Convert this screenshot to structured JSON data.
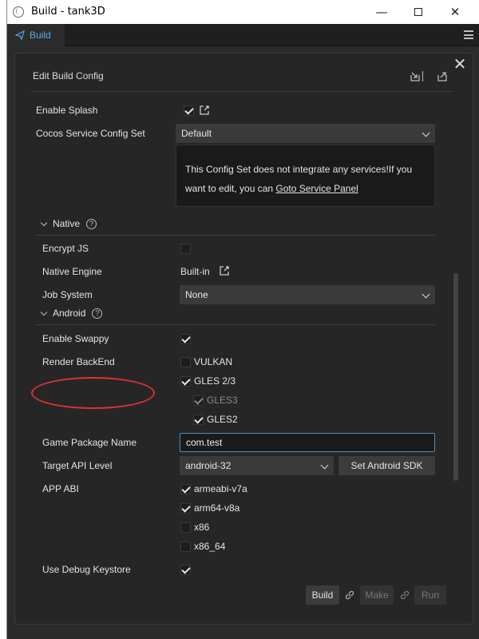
{
  "window": {
    "title": "Build - tank3D"
  },
  "tab": {
    "label": "Build"
  },
  "dialog": {
    "title": "Edit Build Config"
  },
  "general": {
    "enable_splash_label": "Enable Splash",
    "enable_splash_checked": true,
    "service_config_label": "Cocos Service Config Set",
    "service_config_value": "Default",
    "service_notice_text": "This Config Set does not integrate any services!If you want to edit, you can ",
    "service_notice_link": "Goto Service Panel"
  },
  "native": {
    "section_label": "Native",
    "encrypt_js_label": "Encrypt JS",
    "encrypt_js_checked": false,
    "native_engine_label": "Native Engine",
    "native_engine_value": "Built-in",
    "job_system_label": "Job System",
    "job_system_value": "None"
  },
  "android": {
    "section_label": "Android",
    "enable_swappy_label": "Enable Swappy",
    "enable_swappy_checked": true,
    "render_backend_label": "Render BackEnd",
    "render_backends": [
      {
        "label": "VULKAN",
        "checked": false,
        "disabled": false
      },
      {
        "label": "GLES 2/3",
        "checked": true,
        "disabled": false
      },
      {
        "label": "GLES3",
        "checked": true,
        "disabled": true
      },
      {
        "label": "GLES2",
        "checked": true,
        "disabled": false
      }
    ],
    "package_name_label": "Game Package Name",
    "package_name_value": "com.test",
    "target_api_label": "Target API Level",
    "target_api_value": "android-32",
    "set_sdk_label": "Set Android SDK",
    "app_abi_label": "APP ABI",
    "abis": [
      {
        "label": "armeabi-v7a",
        "checked": true
      },
      {
        "label": "arm64-v8a",
        "checked": true
      },
      {
        "label": "x86",
        "checked": false
      },
      {
        "label": "x86_64",
        "checked": false
      }
    ],
    "debug_keystore_label": "Use Debug Keystore",
    "debug_keystore_checked": true
  },
  "footer": {
    "build_label": "Build",
    "make_label": "Make",
    "run_label": "Run"
  },
  "colors": {
    "accent": "#5aa9e6",
    "annotation": "#e03232",
    "panel_bg": "#262626"
  }
}
